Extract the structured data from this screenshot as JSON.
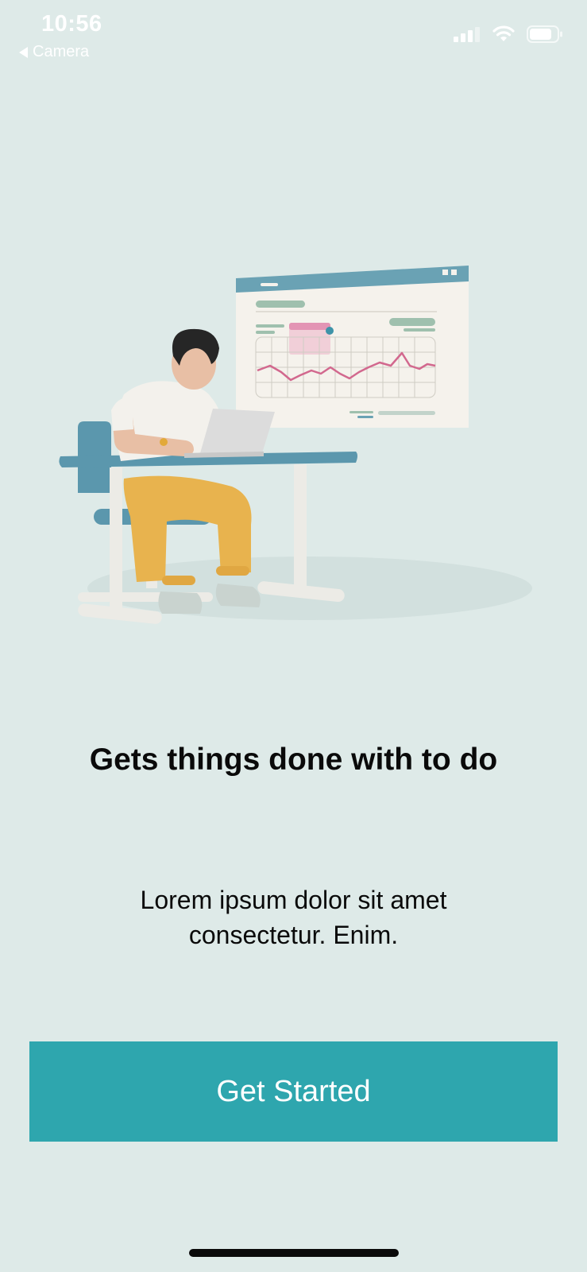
{
  "status_bar": {
    "time": "10:56",
    "back_label": "Camera",
    "icons": [
      "cellular-signal-icon",
      "wifi-icon",
      "battery-icon"
    ]
  },
  "illustration": {
    "subject": "person-at-desk-with-laptop-and-chart-window"
  },
  "onboarding": {
    "title": "Gets things done with to do",
    "description": "Lorem ipsum dolor sit amet consectetur. Enim.",
    "button_label": "Get Started"
  },
  "colors": {
    "background": "#deeae8",
    "accent": "#2ea6ae",
    "text": "#0a0a0a"
  }
}
